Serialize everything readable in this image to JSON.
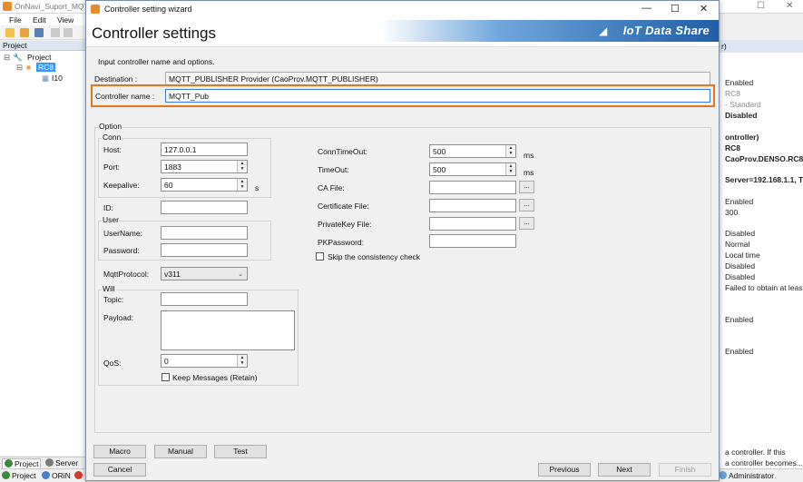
{
  "app": {
    "title": "OnNavi_Suport_MQTT",
    "menu": [
      "File",
      "Edit",
      "View"
    ],
    "project_panel_title": "Project",
    "tree": {
      "root": "Project",
      "controller": "RC8",
      "child": "I10"
    },
    "bottom_tabs": [
      "Project",
      "Server"
    ],
    "status": {
      "project": "Project",
      "orin": "ORiN",
      "user": "Administrator"
    },
    "right_panel": {
      "title": "r)",
      "rows": [
        {
          "text": "Enabled",
          "style": "normal"
        },
        {
          "text": "RC8",
          "style": "gray"
        },
        {
          "text": "- Standard",
          "style": "gray"
        },
        {
          "text": "Disabled",
          "style": "bold"
        },
        {
          "text": "ontroller)",
          "style": "bold"
        },
        {
          "text": "RC8",
          "style": "bold"
        },
        {
          "text": "CaoProv.DENSO.RC8",
          "style": "bold"
        },
        {
          "text": "Server=192.168.1.1, T",
          "style": "bold"
        },
        {
          "text": "Enabled",
          "style": "normal"
        },
        {
          "text": "300",
          "style": "normal"
        },
        {
          "text": "Disabled",
          "style": "normal"
        },
        {
          "text": "Normal",
          "style": "normal"
        },
        {
          "text": "Local time",
          "style": "normal"
        },
        {
          "text": "Disabled",
          "style": "normal"
        },
        {
          "text": "Disabled",
          "style": "normal"
        },
        {
          "text": "Failed to obtain at least",
          "style": "normal"
        },
        {
          "text": "Enabled",
          "style": "normal"
        },
        {
          "text": "Enabled",
          "style": "normal"
        },
        {
          "text": "a controller. If this",
          "style": "normal"
        },
        {
          "text": "a controller becomes...",
          "style": "normal"
        }
      ]
    }
  },
  "dialog": {
    "title": "Controller setting wizard",
    "heading": "Controller settings",
    "brand": "IoT Data Share",
    "instruction": "Input controller name and options.",
    "destination_label": "Destination :",
    "destination_value": "MQTT_PUBLISHER Provider (CaoProv.MQTT_PUBLISHER)",
    "controller_name_label": "Controller name :",
    "controller_name_value": "MQTT_Pub",
    "option_group": "Option",
    "conn_group": "Conn",
    "host_label": "Host:",
    "host_value": "127.0.0.1",
    "port_label": "Port:",
    "port_value": "1883",
    "keepalive_label": "Keepalive:",
    "keepalive_value": "60",
    "keepalive_unit": "s",
    "id_label": "ID:",
    "id_value": "",
    "user_group": "User",
    "username_label": "UserName:",
    "username_value": "",
    "password_label": "Password:",
    "password_value": "",
    "mqttprotocol_label": "MqttProtocol:",
    "mqttprotocol_value": "v311",
    "will_group": "Will",
    "topic_label": "Topic:",
    "topic_value": "",
    "payload_label": "Payload:",
    "payload_value": "",
    "qos_label": "QoS:",
    "qos_value": "0",
    "keep_messages_label": "Keep Messages (Retain)",
    "conntimeout_label": "ConnTimeOut:",
    "conntimeout_value": "500",
    "timeout_label": "TimeOut:",
    "timeout_value": "500",
    "ms_unit": "ms",
    "cafile_label": "CA File:",
    "certfile_label": "Certificate File:",
    "privkey_label": "PrivateKey File:",
    "pkpassword_label": "PKPassword:",
    "browse_label": "...",
    "skip_label": "Skip the consistency check",
    "buttons": {
      "macro": "Macro",
      "manual": "Manual",
      "test": "Test",
      "cancel": "Cancel",
      "previous": "Previous",
      "next": "Next",
      "finish": "Finish"
    },
    "window_controls": {
      "minimize": "—",
      "maximize": "☐",
      "close": "✕"
    }
  },
  "colors": {
    "highlight": "#e8741a",
    "brand_blue": "#1f5fa8",
    "selection": "#3399ff"
  }
}
